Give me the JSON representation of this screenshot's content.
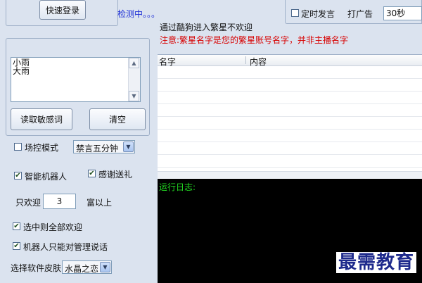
{
  "left": {
    "quick_login_label": "快速登录",
    "sensitive_words": [
      "小雨",
      "大雨"
    ],
    "read_sensitive_label": "读取敏感词",
    "clear_label": "清空",
    "field_control_label": "场控模式",
    "mute_select_value": "禁言五分钟",
    "smart_robot_label": "智能机器人",
    "thank_gift_label": "感谢送礼",
    "welcome_only_label": "只欢迎",
    "welcome_only_value": "3",
    "rich_above_label": "富以上",
    "select_all_welcome_label": "选中则全部欢迎",
    "robot_admin_only_label": "机器人只能对管理说话",
    "skin_label": "选择软件皮肤",
    "skin_value": "水晶之恋"
  },
  "top": {
    "detecting_text": "检测中。。。",
    "timed_speak_label": "定时发言",
    "advertise_label": "打广告",
    "interval_value": "30秒"
  },
  "notice": {
    "welcome_text": "通过酷狗进入繁星不欢迎",
    "warning_text": "注意:繁星名字是您的繁星账号名字，并非主播名字"
  },
  "table": {
    "columns": [
      "名字",
      "内容"
    ]
  },
  "log": {
    "label": "运行日志:"
  },
  "watermark": {
    "text": "最需教育"
  },
  "colors": {
    "detecting": "#1d2fd6",
    "warning": "#d80000",
    "log_label": "#22d622",
    "watermark": "#1e2a8c"
  }
}
